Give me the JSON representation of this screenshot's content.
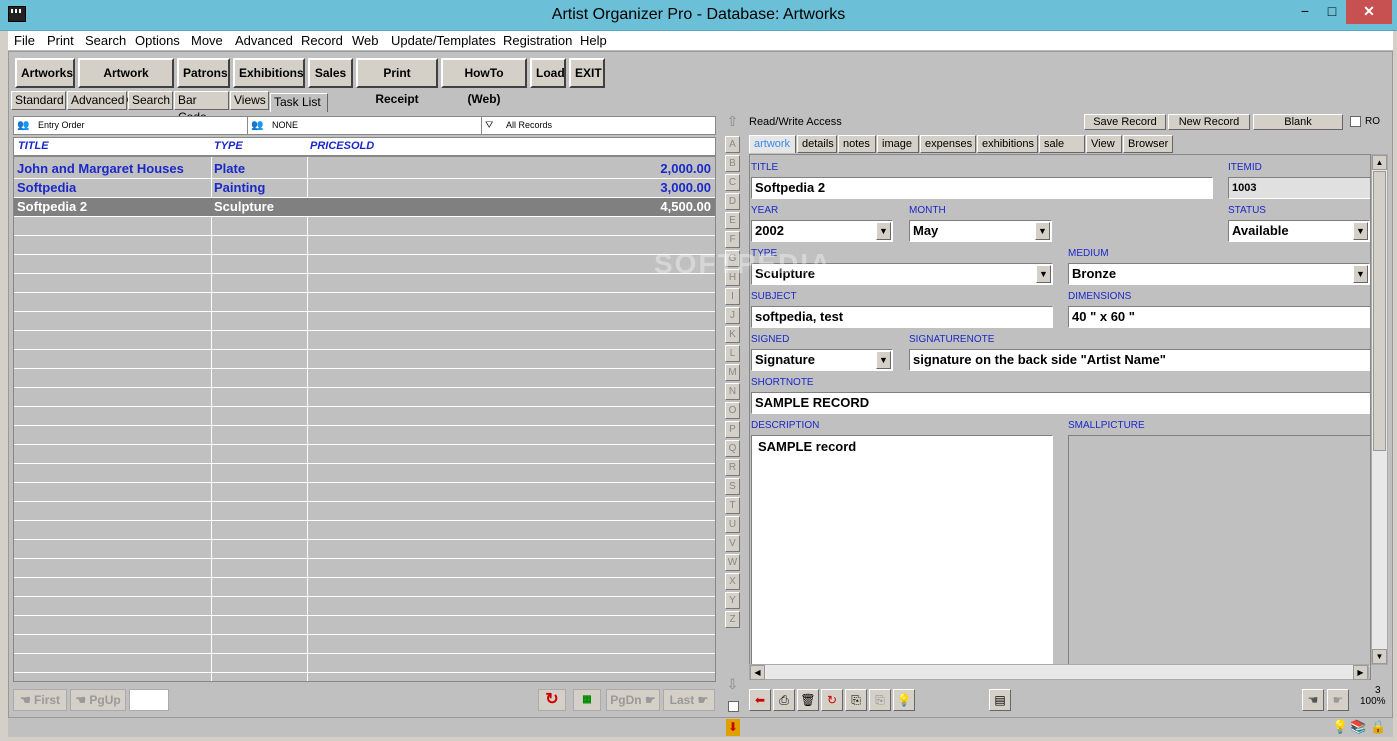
{
  "window": {
    "title": "Artist Organizer Pro - Database: Artworks",
    "min": "−",
    "max": "□",
    "close": "✕"
  },
  "menu": [
    "File",
    "Print",
    "Search",
    "Options",
    "Move",
    "Advanced",
    "Record",
    "Web",
    "Update/Templates",
    "Registration",
    "Help"
  ],
  "toolbar": [
    "Artworks",
    "Artwork Labels",
    "Patrons",
    "Exhibitions",
    "Sales",
    "Print Receipt",
    "HowTo (Web)",
    "Load",
    "EXIT"
  ],
  "view_tabs": [
    "Standard",
    "Advanced",
    "Search",
    "Bar Code",
    "Views",
    "Task List"
  ],
  "sortbar": {
    "order": "Entry Order",
    "filter": "NONE",
    "records": "All Records"
  },
  "grid": {
    "columns": [
      "TITLE",
      "TYPE",
      "PRICESOLD"
    ],
    "rows": [
      {
        "title": "John and Margaret Houses",
        "type": "Plate",
        "price": "2,000.00"
      },
      {
        "title": "Softpedia",
        "type": "Painting",
        "price": "3,000.00"
      },
      {
        "title": "Softpedia 2",
        "type": "Sculpture",
        "price": "4,500.00"
      }
    ]
  },
  "nav": {
    "first": "First",
    "pgup": "PgUp",
    "pgdn": "PgDn",
    "last": "Last"
  },
  "alphabet": [
    "A",
    "B",
    "C",
    "D",
    "E",
    "F",
    "G",
    "H",
    "I",
    "J",
    "K",
    "L",
    "M",
    "N",
    "O",
    "P",
    "Q",
    "R",
    "S",
    "T",
    "U",
    "V",
    "W",
    "X",
    "Y",
    "Z"
  ],
  "right_panel": {
    "access": "Read/Write Access",
    "save_record": "Save Record",
    "new_record": "New Record",
    "blank": "Blank",
    "ro": "RO",
    "tabs": [
      "artwork",
      "details",
      "notes",
      "image",
      "expenses",
      "exhibitions",
      "sale",
      "View",
      "Browser"
    ],
    "fields": {
      "title_label": "TITLE",
      "title": "Softpedia 2",
      "itemid_label": "ITEMID",
      "itemid": "1003",
      "year_label": "YEAR",
      "year": "2002",
      "month_label": "MONTH",
      "month": "May",
      "status_label": "STATUS",
      "status": "Available",
      "type_label": "TYPE",
      "type": "Sculpture",
      "medium_label": "MEDIUM",
      "medium": "Bronze",
      "subject_label": "SUBJECT",
      "subject": "softpedia, test",
      "dimensions_label": "DIMENSIONS",
      "dimensions": "40 \" x 60 \"",
      "signed_label": "SIGNED",
      "signed": "Signature",
      "signaturenote_label": "SIGNATURENOTE",
      "signaturenote": "signature on the back side \"Artist Name\"",
      "shortnote_label": "SHORTNOTE",
      "shortnote": "SAMPLE RECORD",
      "description_label": "DESCRIPTION",
      "description": "SAMPLE record",
      "smallpicture_label": "SMALLPICTURE"
    },
    "counter": "3",
    "zoom": "100%"
  },
  "watermark": "SOFTPEDIA"
}
